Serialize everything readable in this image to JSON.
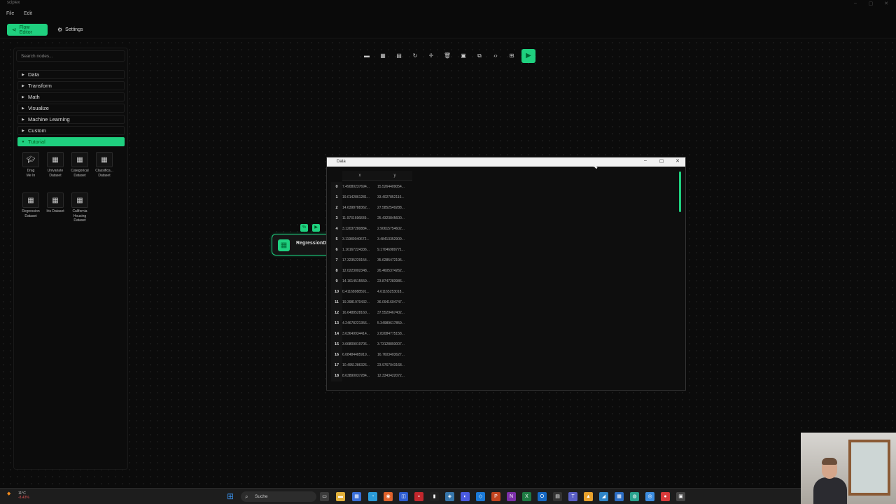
{
  "app": {
    "title": "scipiex",
    "window_controls": [
      "–",
      "▢",
      "✕"
    ]
  },
  "menu": [
    "File",
    "Edit"
  ],
  "nav": {
    "flow_editor": "Flow Editor",
    "settings": "Settings"
  },
  "sidebar": {
    "search_placeholder": "Search nodes...",
    "categories": [
      "Data",
      "Transform",
      "Math",
      "Visualize",
      "Machine Learning",
      "Custom",
      "Tutorial"
    ],
    "open_category": "Tutorial",
    "tiles": [
      {
        "label": "Drag Me In",
        "icon": "graduation-cap-icon"
      },
      {
        "label": "Univariate Dataset",
        "icon": "grid-icon"
      },
      {
        "label": "Categorical Dataset",
        "icon": "grid-icon"
      },
      {
        "label": "Classifica... Dataset",
        "icon": "grid-icon"
      },
      {
        "label": "Regression Dataset",
        "icon": "grid-icon"
      },
      {
        "label": "Iris Dataset",
        "icon": "grid-icon"
      },
      {
        "label": "California Housing Dataset",
        "icon": "grid-icon"
      }
    ]
  },
  "toolbar": {
    "buttons": [
      "folder-icon",
      "grid-view-icon",
      "table-icon",
      "undo-icon",
      "move-icon",
      "delete-icon",
      "save-icon",
      "copy-icon",
      "code-icon",
      "layout-icon"
    ],
    "glyphs": [
      "▬",
      "▦",
      "▤",
      "↻",
      "✛",
      "🗑",
      "▣",
      "⧉",
      "‹›",
      "⊞"
    ],
    "play": "▶"
  },
  "node": {
    "title": "RegressionD",
    "tools": [
      "%",
      "▶"
    ]
  },
  "data_window": {
    "title": "Data",
    "columns": [
      "x",
      "y"
    ],
    "rows": [
      {
        "i": "0",
        "x": "7.49080237694...",
        "y": "15.5264409054..."
      },
      {
        "i": "1",
        "x": "19.0142861281...",
        "y": "33.4027852116..."
      },
      {
        "i": "2",
        "x": "14.6398788362...",
        "y": "27.5852549288..."
      },
      {
        "i": "3",
        "x": "11.9731696839...",
        "y": "25.4323845600..."
      },
      {
        "i": "4",
        "x": "3.12037280884...",
        "y": "2.90615754602..."
      },
      {
        "i": "5",
        "x": "3.11989040672...",
        "y": "3.48413352909..."
      },
      {
        "i": "6",
        "x": "1.16167224336...",
        "y": "9.17046989771..."
      },
      {
        "i": "7",
        "x": "17.3235229154...",
        "y": "35.6285472195..."
      },
      {
        "i": "8",
        "x": "12.0223002348...",
        "y": "26.4605374262..."
      },
      {
        "i": "9",
        "x": "14.1614515559...",
        "y": "23.8747283986..."
      },
      {
        "i": "10",
        "x": "0.41168988591...",
        "y": "4.61165253018..."
      },
      {
        "i": "11",
        "x": "19.3981970432...",
        "y": "36.0941604747..."
      },
      {
        "i": "12",
        "x": "16.6488528160...",
        "y": "37.5529467402..."
      },
      {
        "i": "13",
        "x": "4.24678221356...",
        "y": "5.34989617859..."
      },
      {
        "i": "14",
        "x": "3.63649934414...",
        "y": "2.82084775158..."
      },
      {
        "i": "15",
        "x": "3.66809019706...",
        "y": "3.73128893007..."
      },
      {
        "i": "16",
        "x": "6.08484485919...",
        "y": "16.7603403627..."
      },
      {
        "i": "17",
        "x": "10.4951286326...",
        "y": "23.9767043168..."
      },
      {
        "i": "18",
        "x": "8.63890037284...",
        "y": "12.3343422072..."
      }
    ]
  },
  "taskbar": {
    "weather_temp": "11°C",
    "weather_change": "-8,43%",
    "search_label": "Suche",
    "apps": [
      {
        "name": "file-explorer-icon",
        "glyph": "▭",
        "color": "#3b3b3b"
      },
      {
        "name": "folder-icon",
        "glyph": "▬",
        "color": "#e2b13c"
      },
      {
        "name": "store-icon",
        "glyph": "▦",
        "color": "#3a6fd8"
      },
      {
        "name": "edge-icon",
        "glyph": "◔",
        "color": "#2a9bd8"
      },
      {
        "name": "firefox-icon",
        "glyph": "◉",
        "color": "#e0632c"
      },
      {
        "name": "bitwarden-icon",
        "glyph": "◫",
        "color": "#2d5dd0"
      },
      {
        "name": "app-red-icon",
        "glyph": "▪",
        "color": "#c2272d"
      },
      {
        "name": "terminal-icon",
        "glyph": "▮",
        "color": "#222"
      },
      {
        "name": "python-icon",
        "glyph": "◈",
        "color": "#3776ab"
      },
      {
        "name": "github-icon",
        "glyph": "◐",
        "color": "#4a5ae0"
      },
      {
        "name": "vscode-icon",
        "glyph": "◇",
        "color": "#1a7ad8"
      },
      {
        "name": "powerpoint-icon",
        "glyph": "P",
        "color": "#c4441f"
      },
      {
        "name": "onenote-icon",
        "glyph": "N",
        "color": "#7b2fa8"
      },
      {
        "name": "excel-icon",
        "glyph": "X",
        "color": "#1e7a43"
      },
      {
        "name": "outlook-icon",
        "glyph": "O",
        "color": "#1568c4"
      },
      {
        "name": "app-dark-icon",
        "glyph": "▤",
        "color": "#333"
      },
      {
        "name": "teams-icon",
        "glyph": "T",
        "color": "#5a5fc7"
      },
      {
        "name": "warning-icon",
        "glyph": "▲",
        "color": "#e9a22c"
      },
      {
        "name": "app-active-icon",
        "glyph": "◢",
        "color": "#2f86c8"
      },
      {
        "name": "calc-icon",
        "glyph": "▦",
        "color": "#2c6ec4"
      },
      {
        "name": "app-teal-icon",
        "glyph": "◍",
        "color": "#2aa28e"
      },
      {
        "name": "app-blue2-icon",
        "glyph": "◎",
        "color": "#3c8de0"
      },
      {
        "name": "app-red2-icon",
        "glyph": "●",
        "color": "#d93a3a"
      },
      {
        "name": "app-grey-icon",
        "glyph": "▣",
        "color": "#444"
      }
    ]
  },
  "colors": {
    "accent": "#1fd07f",
    "background": "#0b0b0b"
  }
}
